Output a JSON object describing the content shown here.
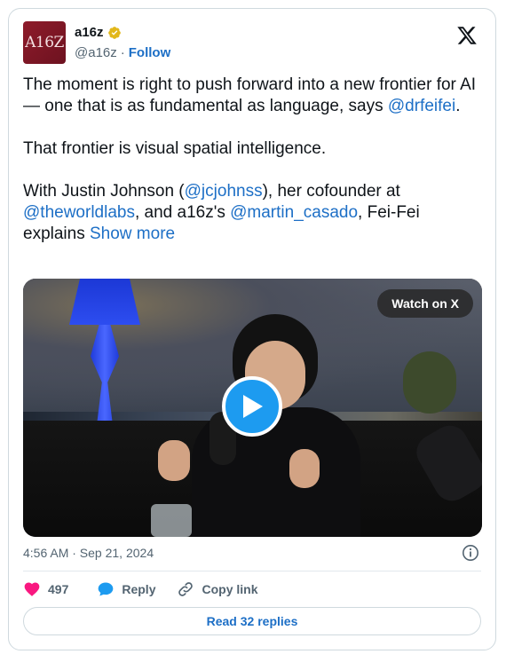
{
  "author": {
    "avatar_text": "A16Z",
    "name": "a16z",
    "handle": "@a16z",
    "separator": "·",
    "follow_label": "Follow"
  },
  "tweet": {
    "p1_text": "The moment is right to push forward into a new frontier for AI — one that is as fundamental as language, says ",
    "p1_mention": "@drfeifei",
    "p1_end": ".",
    "p2_text": "That frontier is visual spatial intelligence.",
    "p3_a": "With Justin Johnson (",
    "p3_m1": "@jcjohnss",
    "p3_b": "), her cofounder at ",
    "p3_m2": "@theworldlabs",
    "p3_c": ", and a16z's ",
    "p3_m3": "@martin_casado",
    "p3_d": ", Fei-Fei explains ",
    "show_more": "Show more"
  },
  "video": {
    "watch_label": "Watch on X"
  },
  "meta": {
    "timestamp": "4:56 AM · Sep 21, 2024"
  },
  "actions": {
    "like_count": "497",
    "reply_label": "Reply",
    "copy_label": "Copy link"
  },
  "read_replies": "Read 32 replies",
  "colors": {
    "link": "#1d6fc6",
    "like": "#f91880",
    "reply": "#1d9bf0",
    "verified": "#e2b719"
  }
}
